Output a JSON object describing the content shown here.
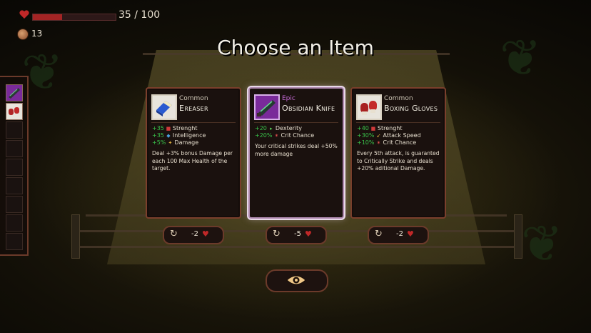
{
  "hud": {
    "hp_text": "35 / 100",
    "hp_fraction": 0.35,
    "gold": "13",
    "heart_icon": "heart-icon",
    "coin_icon": "coin-icon"
  },
  "title": "Choose an Item",
  "inventory": {
    "slots": [
      "obsidian-knife",
      "boxing-gloves",
      "",
      "",
      "",
      "",
      "",
      "",
      "",
      ""
    ]
  },
  "items": [
    {
      "rarity": "Common",
      "name": "Ereaser",
      "icon": "eraser-icon",
      "stats": [
        {
          "value": "+35",
          "icon": "strength-icon",
          "label": "Strenght"
        },
        {
          "value": "+35",
          "icon": "intelligence-icon",
          "label": "Intelligence"
        },
        {
          "value": "+5%",
          "icon": "damage-icon",
          "label": "Damage"
        }
      ],
      "description": "Deal +3% bonus Damage per each 100 Max Health of the target.",
      "cost": "-2"
    },
    {
      "rarity": "Epic",
      "name": "Obsidian Knife",
      "icon": "obsidian-knife-icon",
      "stats": [
        {
          "value": "+20",
          "icon": "dexterity-icon",
          "label": "Dexterity"
        },
        {
          "value": "+20%",
          "icon": "crit-chance-icon",
          "label": "Crit Chance"
        }
      ],
      "description": "Your critical strikes deal +50% more damage",
      "cost": "-5"
    },
    {
      "rarity": "Common",
      "name": "Boxing Gloves",
      "icon": "boxing-gloves-icon",
      "stats": [
        {
          "value": "+40",
          "icon": "strength-icon",
          "label": "Strenght"
        },
        {
          "value": "+30%",
          "icon": "attack-speed-icon",
          "label": "Attack Speed"
        },
        {
          "value": "+10%",
          "icon": "crit-chance-icon",
          "label": "Crit Chance"
        }
      ],
      "description": "Every 5th attack, is guaranted to Critically Strike and deals +20% aditional Damage.",
      "cost": "-2"
    }
  ],
  "colors": {
    "epic": "#c66ad6",
    "stat_green": "#39c24a",
    "hp_red": "#a32424",
    "frame_brown": "#7a3f2c"
  }
}
